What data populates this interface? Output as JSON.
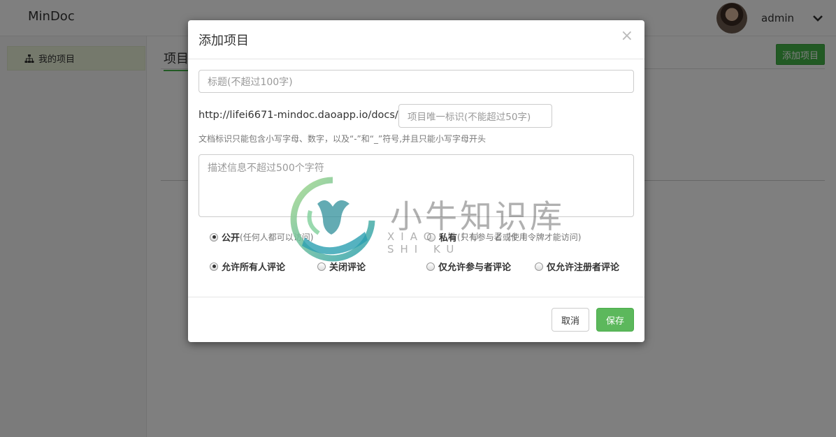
{
  "app": {
    "brand": "MinDoc"
  },
  "user": {
    "name": "admin"
  },
  "sidebar": {
    "items": [
      {
        "label": "我的项目",
        "icon": "sitemap-icon"
      }
    ]
  },
  "main": {
    "title": "项目",
    "add_button": "添加项目"
  },
  "modal": {
    "title": "添加项目",
    "close": "×",
    "title_placeholder": "标题(不超过100字)",
    "url_prefix": "http://lifei6671-mindoc.daoapp.io/docs/",
    "ident_placeholder": "项目唯一标识(不能超过50字)",
    "ident_help": "文档标识只能包含小写字母、数字，以及“-”和“_”符号,并且只能小写字母开头",
    "desc_placeholder": "描述信息不超过500个字符",
    "visibility": [
      {
        "label": "公开",
        "hint": "(任何人都可以访问)",
        "checked": true
      },
      {
        "label": "私有",
        "hint": "(只有参与者或使用令牌才能访问)",
        "checked": false
      }
    ],
    "comments": [
      {
        "label": "允许所有人评论",
        "checked": true
      },
      {
        "label": "关闭评论",
        "checked": false
      },
      {
        "label": "仅允许参与者评论",
        "checked": false
      },
      {
        "label": "仅允许注册者评论",
        "checked": false
      }
    ],
    "cancel": "取消",
    "save": "保存"
  },
  "watermark": {
    "title": "小牛知识库",
    "subtitle": "XIAO NIU ZHI SHI KU"
  },
  "colors": {
    "accent_green": "#44b549",
    "save_green": "#5cb85c",
    "watermark_teal": "#3aa7a0"
  }
}
